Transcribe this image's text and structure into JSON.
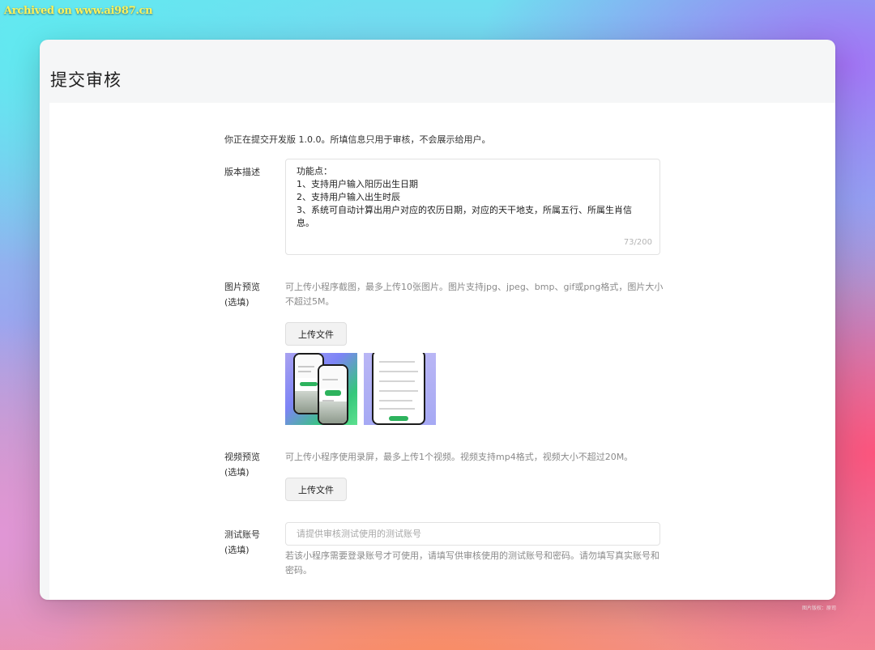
{
  "watermark": "Archived on www.ai987.cn",
  "corner_credit": "图片版权：原司",
  "page": {
    "title": "提交审核",
    "intro": "你正在提交开发版 1.0.0。所填信息只用于审核，不会展示给用户。"
  },
  "version_desc": {
    "label": "版本描述",
    "value": "功能点：\n1、支持用户输入阳历出生日期\n2、支持用户输入出生时辰\n3、系统可自动计算出用户对应的农历日期，对应的天干地支，所属五行、所属生肖信息。",
    "counter": "73/200"
  },
  "image_preview": {
    "label_line1": "图片预览",
    "label_line2": "(选填)",
    "hint": "可上传小程序截图，最多上传10张图片。图片支持jpg、jpeg、bmp、gif或png格式，图片大小不超过5M。",
    "upload_label": "上传文件"
  },
  "video_preview": {
    "label_line1": "视频预览",
    "label_line2": "(选填)",
    "hint": "可上传小程序使用录屏，最多上传1个视频。视频支持mp4格式，视频大小不超过20M。",
    "upload_label": "上传文件"
  },
  "test_account": {
    "label_line1": "测试账号",
    "label_line2": "(选填)",
    "placeholder": "请提供审核测试使用的测试账号",
    "hint": "若该小程序需要登录账号才可使用，请填写供审核使用的测试账号和密码。请勿填写真实账号和密码。"
  }
}
